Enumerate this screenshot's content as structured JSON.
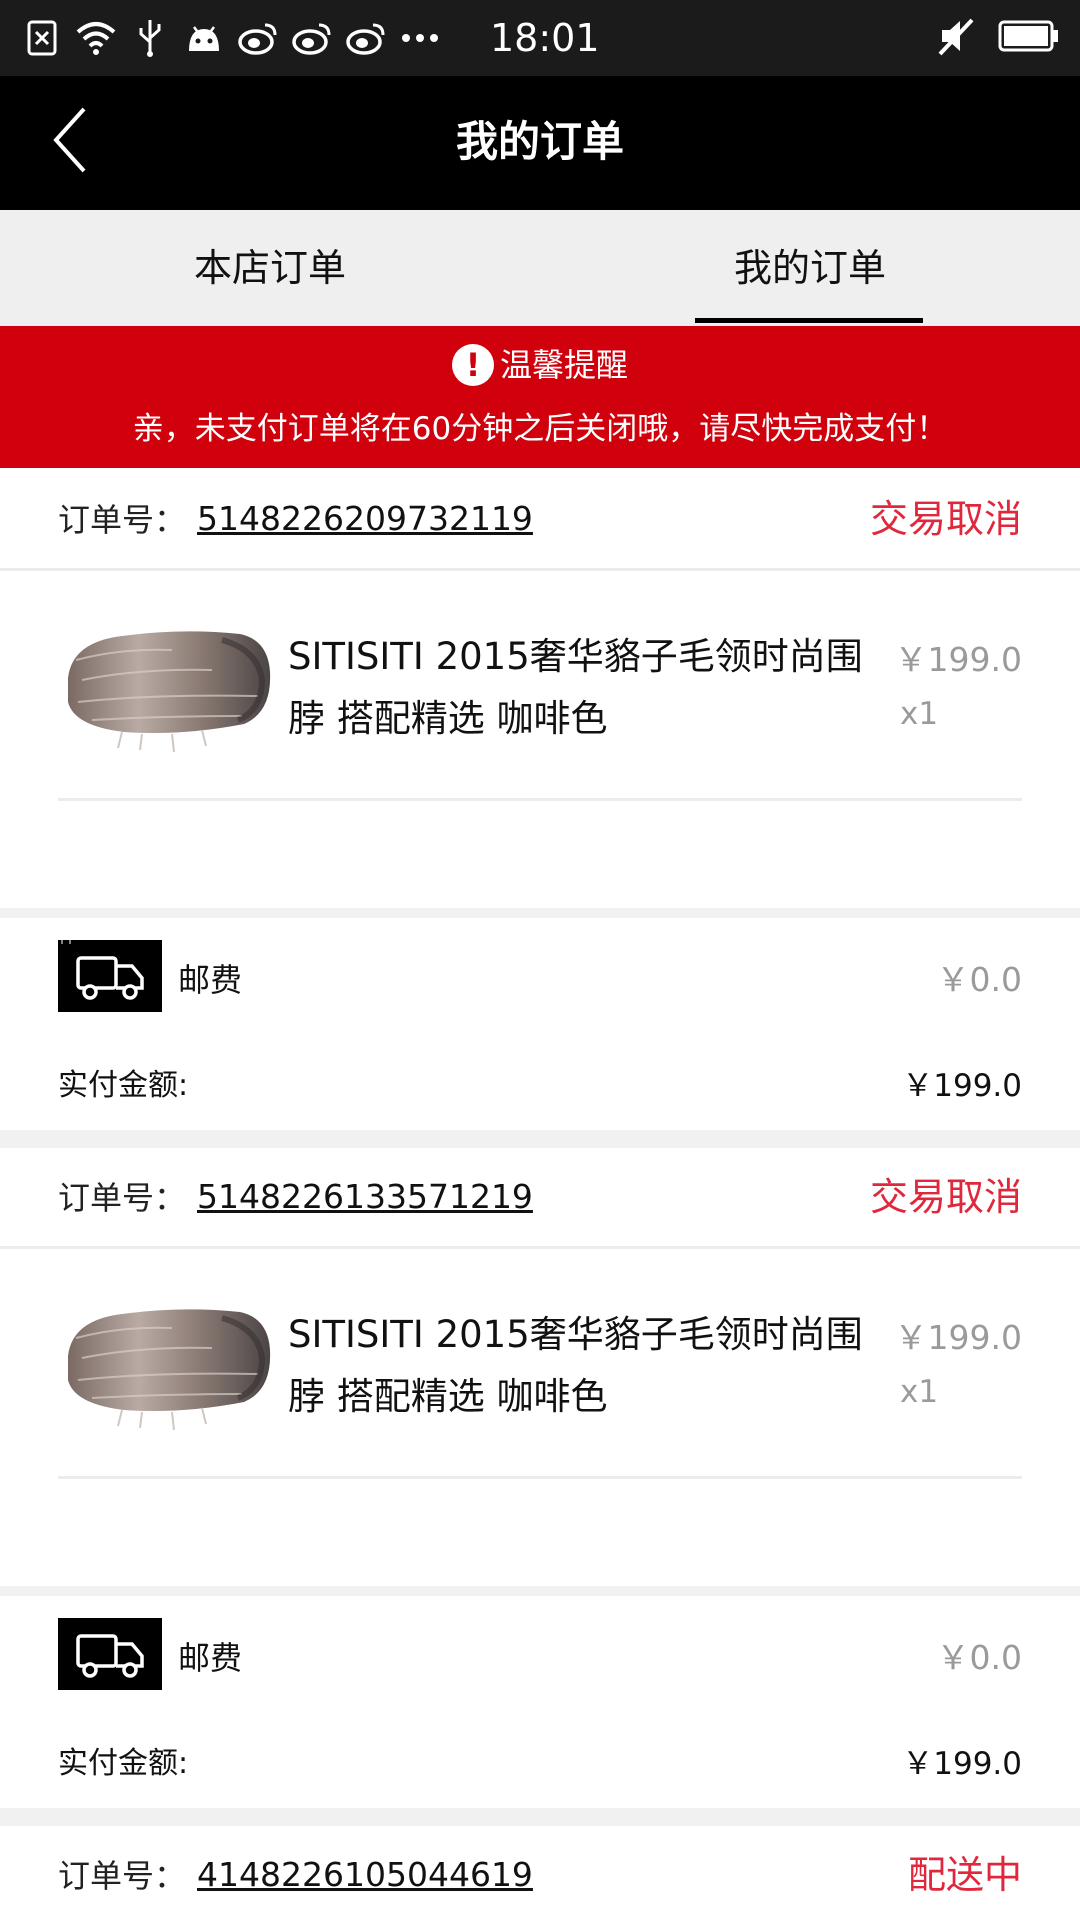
{
  "status_bar": {
    "time": "18:01",
    "left_icons": [
      "notification-x-icon",
      "wifi-icon",
      "usb-icon",
      "android-icon",
      "weibo-icon",
      "weibo-icon",
      "weibo-icon",
      "more-dots-icon"
    ],
    "right_icons": [
      "mute-icon",
      "battery-icon"
    ]
  },
  "header": {
    "title": "我的订单",
    "back_icon": "chevron-left-icon"
  },
  "tabs": [
    {
      "label": "本店订单",
      "active": false
    },
    {
      "label": "我的订单",
      "active": true
    }
  ],
  "notice": {
    "title": "温馨提醒",
    "icon": "exclamation-icon",
    "message": "亲，未支付订单将在60分钟之后关闭哦，请尽快完成支付！"
  },
  "orders": [
    {
      "order_label": "订单号：",
      "order_number": "5148226209732119",
      "status": "交易取消",
      "item": {
        "name": "SITISITI 2015奢华貉子毛领时尚围脖 搭配精选 咖啡色",
        "price": "￥199.0",
        "qty": "x1"
      },
      "shipping_label": "邮费",
      "shipping_value": "￥0.0",
      "paid_label": "实付金额:",
      "paid_value": "￥199.0"
    },
    {
      "order_label": "订单号：",
      "order_number": "5148226133571219",
      "status": "交易取消",
      "item": {
        "name": "SITISITI 2015奢华貉子毛领时尚围脖 搭配精选 咖啡色",
        "price": "￥199.0",
        "qty": "x1"
      },
      "shipping_label": "邮费",
      "shipping_value": "￥0.0",
      "paid_label": "实付金额:",
      "paid_value": "￥199.0"
    },
    {
      "order_label": "订单号：",
      "order_number": "4148226105044619",
      "status": "配送中"
    }
  ],
  "colors": {
    "header_bg": "#000000",
    "notice_bg": "#d0000c",
    "status_red": "#e0283d",
    "tab_bg": "#efeff0"
  }
}
